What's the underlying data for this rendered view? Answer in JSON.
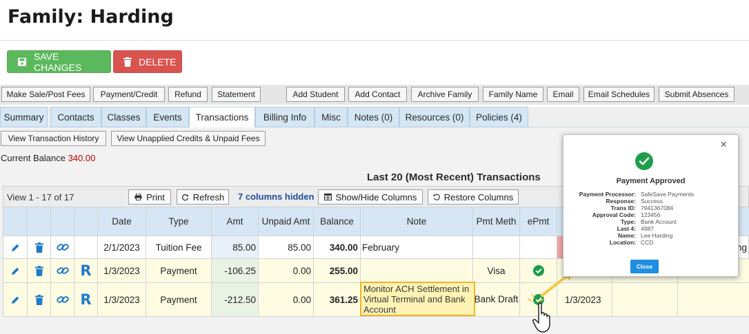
{
  "page_title": "Family: Harding",
  "buttons": {
    "save": "SAVE CHANGES",
    "delete": "DELETE"
  },
  "actions": [
    "Make Sale/Post Fees",
    "Payment/Credit",
    "Refund",
    "Statement",
    "Add Student",
    "Add Contact",
    "Archive Family",
    "Family Name",
    "Email",
    "Email Schedules",
    "Submit Absences"
  ],
  "tabs": [
    "Summary",
    "Contacts",
    "Classes",
    "Events",
    "Transactions",
    "Billing Info",
    "Misc",
    "Notes (0)",
    "Resources (0)",
    "Policies (4)"
  ],
  "active_tab": "Transactions",
  "sub_buttons": [
    "View Transaction History",
    "View Unapplied Credits & Unpaid Fees"
  ],
  "balance": {
    "label": "Current Balance",
    "value": "340.00",
    "value_color": "#c00000"
  },
  "grid_title": "Last 20 (Most Recent) Transactions",
  "grid_toolbar": {
    "view_count": "View 1 - 17 of 17",
    "print": "Print",
    "refresh": "Refresh",
    "hidden_columns": "7 columns hidden",
    "show_hide": "Show/Hide Columns",
    "restore": "Restore Columns"
  },
  "columns": [
    "Date",
    "Type",
    "Amt",
    "Unpaid Amt",
    "Balance",
    "Note",
    "Pmt Meth",
    "ePmt"
  ],
  "rows": [
    {
      "date": "2/1/2023",
      "type": "Tuition Fee",
      "amt": "85.00",
      "unpaid": "85.00",
      "balance": "340.00",
      "note": "February",
      "meth": "",
      "epmt": false,
      "refund": false,
      "date2": "",
      "trail": "ng"
    },
    {
      "date": "1/3/2023",
      "type": "Payment",
      "amt": "-106.25",
      "unpaid": "0.00",
      "balance": "255.00",
      "note": "",
      "meth": "Visa",
      "epmt": true,
      "refund": true,
      "date2": "",
      "trail": ""
    },
    {
      "date": "1/3/2023",
      "type": "Payment",
      "amt": "-212.50",
      "unpaid": "0.00",
      "balance": "361.25",
      "note": "",
      "meth": "Bank Draft",
      "epmt": true,
      "refund": true,
      "date2": "1/3/2023",
      "trail": ""
    }
  ],
  "refund_marker": "R",
  "highlighted_note": "Monitor ACH Settlement in Virtual Terminal and Bank Account",
  "popup": {
    "close_glyph": "×",
    "title": "Payment Approved",
    "fields": [
      {
        "key": "Payment Processor:",
        "value": "SafeSave Payments"
      },
      {
        "key": "Response:",
        "value": "Success"
      },
      {
        "key": "Trans ID:",
        "value": "7941367084"
      },
      {
        "key": "Approval Code:",
        "value": "123456"
      },
      {
        "key": "Type:",
        "value": "Bank Account"
      },
      {
        "key": "Last 4:",
        "value": "4987"
      },
      {
        "key": "Name:",
        "value": "Lee Harding"
      },
      {
        "key": "Location:",
        "value": "CCD"
      }
    ],
    "close_button": "Close"
  },
  "colors": {
    "accent_blue": "#1f7ac9",
    "success_green": "#1e9e4a",
    "highlight_yellow": "#fff3b3",
    "row_tint": "#fdfce3"
  },
  "icons": [
    "save-icon",
    "trash-icon",
    "pencil-icon",
    "link-icon",
    "print-icon",
    "refresh-icon",
    "columns-icon",
    "restore-icon",
    "check-icon",
    "hand-cursor-icon",
    "arrow-icon"
  ]
}
